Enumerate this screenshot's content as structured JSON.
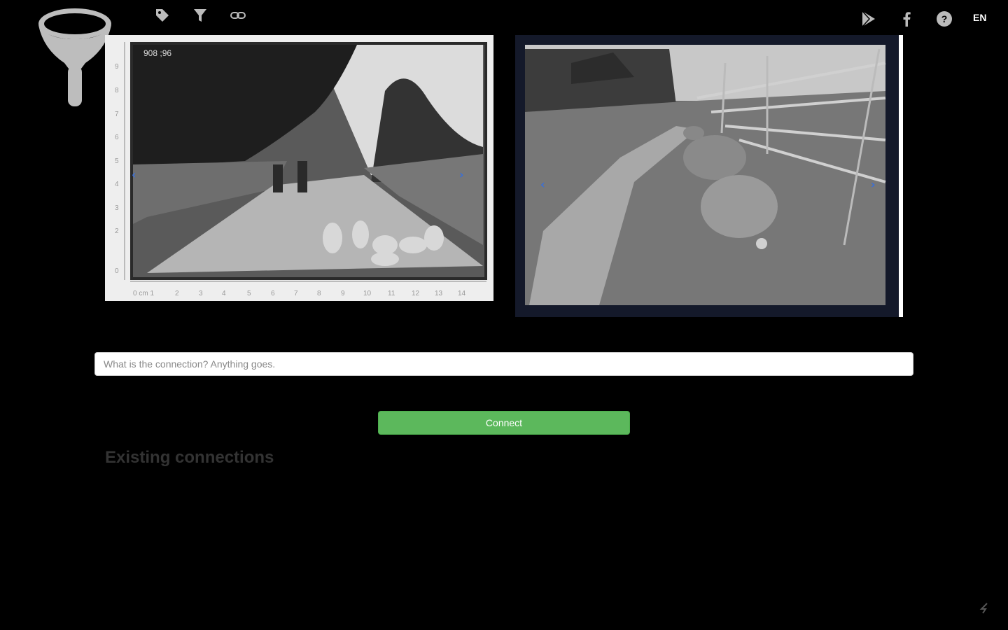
{
  "app": {
    "logo_icon": "funnel-logo-icon",
    "colors": {
      "background": "#000000",
      "accent_green": "#5cb85c",
      "icon_gray": "#bbbbbb"
    }
  },
  "toolbar": {
    "icons": [
      "tag-icon",
      "filter-icon",
      "link-icon"
    ]
  },
  "topbar_right": {
    "icons": [
      "google-play-icon",
      "facebook-icon",
      "help-icon"
    ],
    "language": "EN"
  },
  "photos": {
    "left": {
      "ruler_top_label": "908 ;96",
      "arrow_prev": "‹",
      "arrow_next": "›"
    },
    "right": {
      "arrow_prev": "‹",
      "arrow_next": "›"
    }
  },
  "connection_form": {
    "placeholder": "What is the connection? Anything goes.",
    "value": "",
    "connect_label": "Connect"
  },
  "existing": {
    "title": "Existing connections"
  }
}
